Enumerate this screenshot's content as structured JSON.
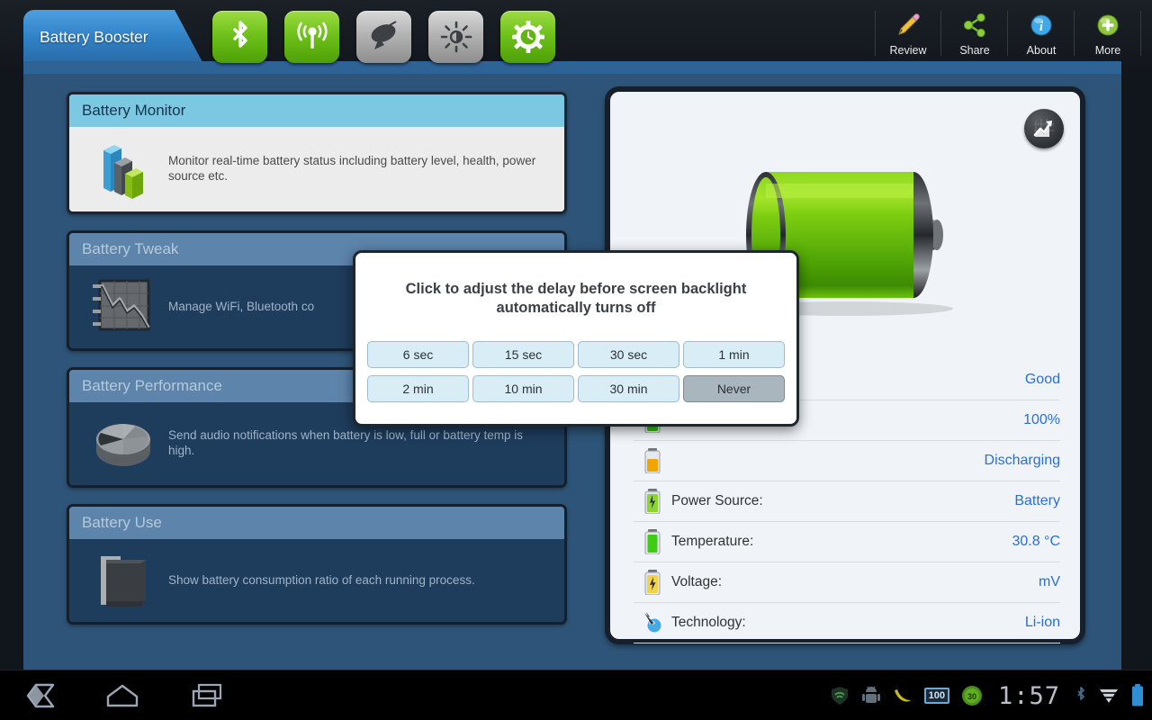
{
  "app": {
    "title": "Battery Booster"
  },
  "toggles": [
    {
      "name": "bluetooth",
      "state": "on"
    },
    {
      "name": "wifi",
      "state": "on"
    },
    {
      "name": "gps",
      "state": "off"
    },
    {
      "name": "brightness",
      "state": "off"
    },
    {
      "name": "screen-timeout",
      "state": "on"
    }
  ],
  "actions": [
    {
      "label": "Review",
      "icon": "pencil-icon"
    },
    {
      "label": "Share",
      "icon": "share-icon"
    },
    {
      "label": "About",
      "icon": "info-icon"
    },
    {
      "label": "More",
      "icon": "plus-icon"
    }
  ],
  "cards": [
    {
      "title": "Battery Monitor",
      "desc": "Monitor real-time battery status including battery level, health, power source etc.",
      "icon": "bar-chart-3d-icon",
      "state": "active"
    },
    {
      "title": "Battery Tweak",
      "desc": "Manage WiFi, Bluetooth co",
      "icon": "line-chart-icon",
      "state": "dim"
    },
    {
      "title": "Battery Performance",
      "desc": "Send audio notifications when battery is low, full or battery temp is high.",
      "icon": "pie-chart-3d-icon",
      "state": "dim"
    },
    {
      "title": "Battery Use",
      "desc": "Show battery consumption ratio of each running process.",
      "icon": "folder-icon",
      "state": "dim"
    }
  ],
  "battery_panel": {
    "graph_button_icon": "trend-graph-icon",
    "battery_icon": "battery-full-3d-icon",
    "rows": [
      {
        "label": "",
        "value": "Good",
        "icon": "battery-health-icon",
        "label_hidden": true
      },
      {
        "label": "",
        "value": "100%",
        "icon": "battery-level-icon",
        "label_hidden": true
      },
      {
        "label": "",
        "value": "Discharging",
        "icon": "battery-status-icon",
        "label_hidden": true
      },
      {
        "label": "Power Source:",
        "value": "Battery",
        "icon": "power-source-icon",
        "label_hidden": false
      },
      {
        "label": "Temperature:",
        "value": "30.8 °C",
        "icon": "temperature-icon",
        "label_hidden": false
      },
      {
        "label": "Voltage:",
        "value": "mV",
        "icon": "voltage-icon",
        "label_hidden": false
      },
      {
        "label": "Technology:",
        "value": "Li-ion",
        "icon": "technology-icon",
        "label_hidden": false
      }
    ]
  },
  "dialog": {
    "title": "Click to adjust the delay before screen backlight automatically turns off",
    "options": [
      {
        "label": "6 sec",
        "selected": false
      },
      {
        "label": "15 sec",
        "selected": false
      },
      {
        "label": "30 sec",
        "selected": false
      },
      {
        "label": "1 min",
        "selected": false
      },
      {
        "label": "2 min",
        "selected": false
      },
      {
        "label": "10 min",
        "selected": false
      },
      {
        "label": "30 min",
        "selected": false
      },
      {
        "label": "Never",
        "selected": true
      }
    ]
  },
  "navbar": {
    "buttons": [
      {
        "name": "back-icon"
      },
      {
        "name": "home-icon"
      },
      {
        "name": "recents-icon"
      }
    ],
    "status": {
      "clock": "1:57",
      "badge_number": "100",
      "circle_badge_number": "30",
      "icons": [
        "shield-wifi-icon",
        "android-robot-icon",
        "banana-icon",
        "bluetooth-status-icon",
        "signal-icon",
        "battery-status-bar-icon"
      ]
    }
  },
  "colors": {
    "accent_blue": "#2a6fd4",
    "app_background": "#2e5579",
    "tab_blue": "#2f7fc4",
    "header_active": "#7cc8e2",
    "toggle_on_green": "#6fc21b",
    "option_blue": "#d9edf7",
    "option_selected_gray": "#a9b6bd"
  }
}
